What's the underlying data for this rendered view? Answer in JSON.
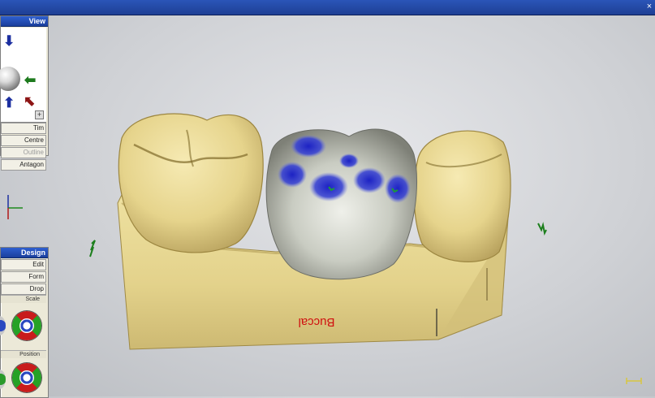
{
  "view_panel": {
    "title": "View",
    "buttons": [
      {
        "label": "Tim",
        "enabled": true
      },
      {
        "label": "Centre",
        "enabled": true
      },
      {
        "label": "Outline",
        "enabled": false
      },
      {
        "label": "Antagon",
        "enabled": true
      }
    ]
  },
  "design_panel": {
    "title": "Design",
    "buttons": [
      "Edit",
      "Form",
      "Drop"
    ],
    "sections": [
      "Scale",
      "Position"
    ]
  },
  "viewport": {
    "annotation": "Buccal"
  },
  "icons": {
    "view_up": "arrow-up-icon",
    "view_down": "arrow-down-icon",
    "view_right": "arrow-left-green-icon",
    "view_diag": "arrow-diagonal-red-icon",
    "axis": "axis-triad-icon",
    "scale": "scale-bar-icon"
  },
  "colors": {
    "model_yellow": "#e8d98f",
    "crown_grey": "#bfc3b8",
    "contact_blue": "#2a33c8",
    "annotation_red": "#d01010"
  }
}
